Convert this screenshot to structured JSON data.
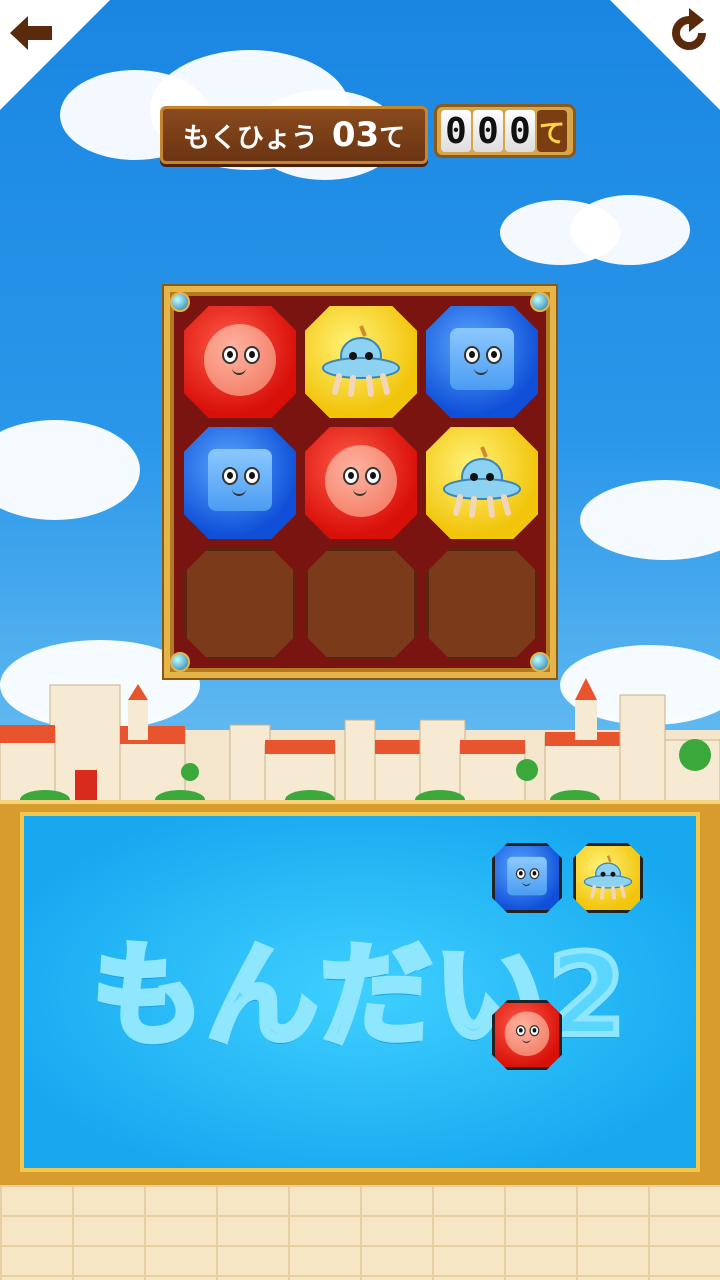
{
  "header": {
    "goal_label": "もくひょう",
    "goal_value": "03",
    "goal_unit": "て",
    "moves_digits": [
      "0",
      "0",
      "0"
    ],
    "moves_unit": "て"
  },
  "buttons": {
    "back_icon": "back-arrow-icon",
    "restart_icon": "restart-icon"
  },
  "board": {
    "cells": [
      {
        "color": "red",
        "character": "red-round-face"
      },
      {
        "color": "yellow",
        "character": "ufo-alien"
      },
      {
        "color": "blue",
        "character": "blue-square-face"
      },
      {
        "color": "blue",
        "character": "blue-square-face"
      },
      {
        "color": "red",
        "character": "red-round-face"
      },
      {
        "color": "yellow",
        "character": "ufo-alien"
      },
      {
        "color": "empty",
        "character": ""
      },
      {
        "color": "empty",
        "character": ""
      },
      {
        "color": "empty",
        "character": ""
      }
    ]
  },
  "panel": {
    "title": "もんだい2",
    "pieces": [
      {
        "color": "blue",
        "character": "blue-square-face"
      },
      {
        "color": "yellow",
        "character": "ufo-alien"
      },
      {
        "color": "red",
        "character": "red-round-face"
      }
    ]
  },
  "colors": {
    "red": "#e0140c",
    "yellow": "#f4c80c",
    "blue": "#1458dc",
    "sky": "#1f8fe6",
    "panel": "#2cc0fa"
  }
}
